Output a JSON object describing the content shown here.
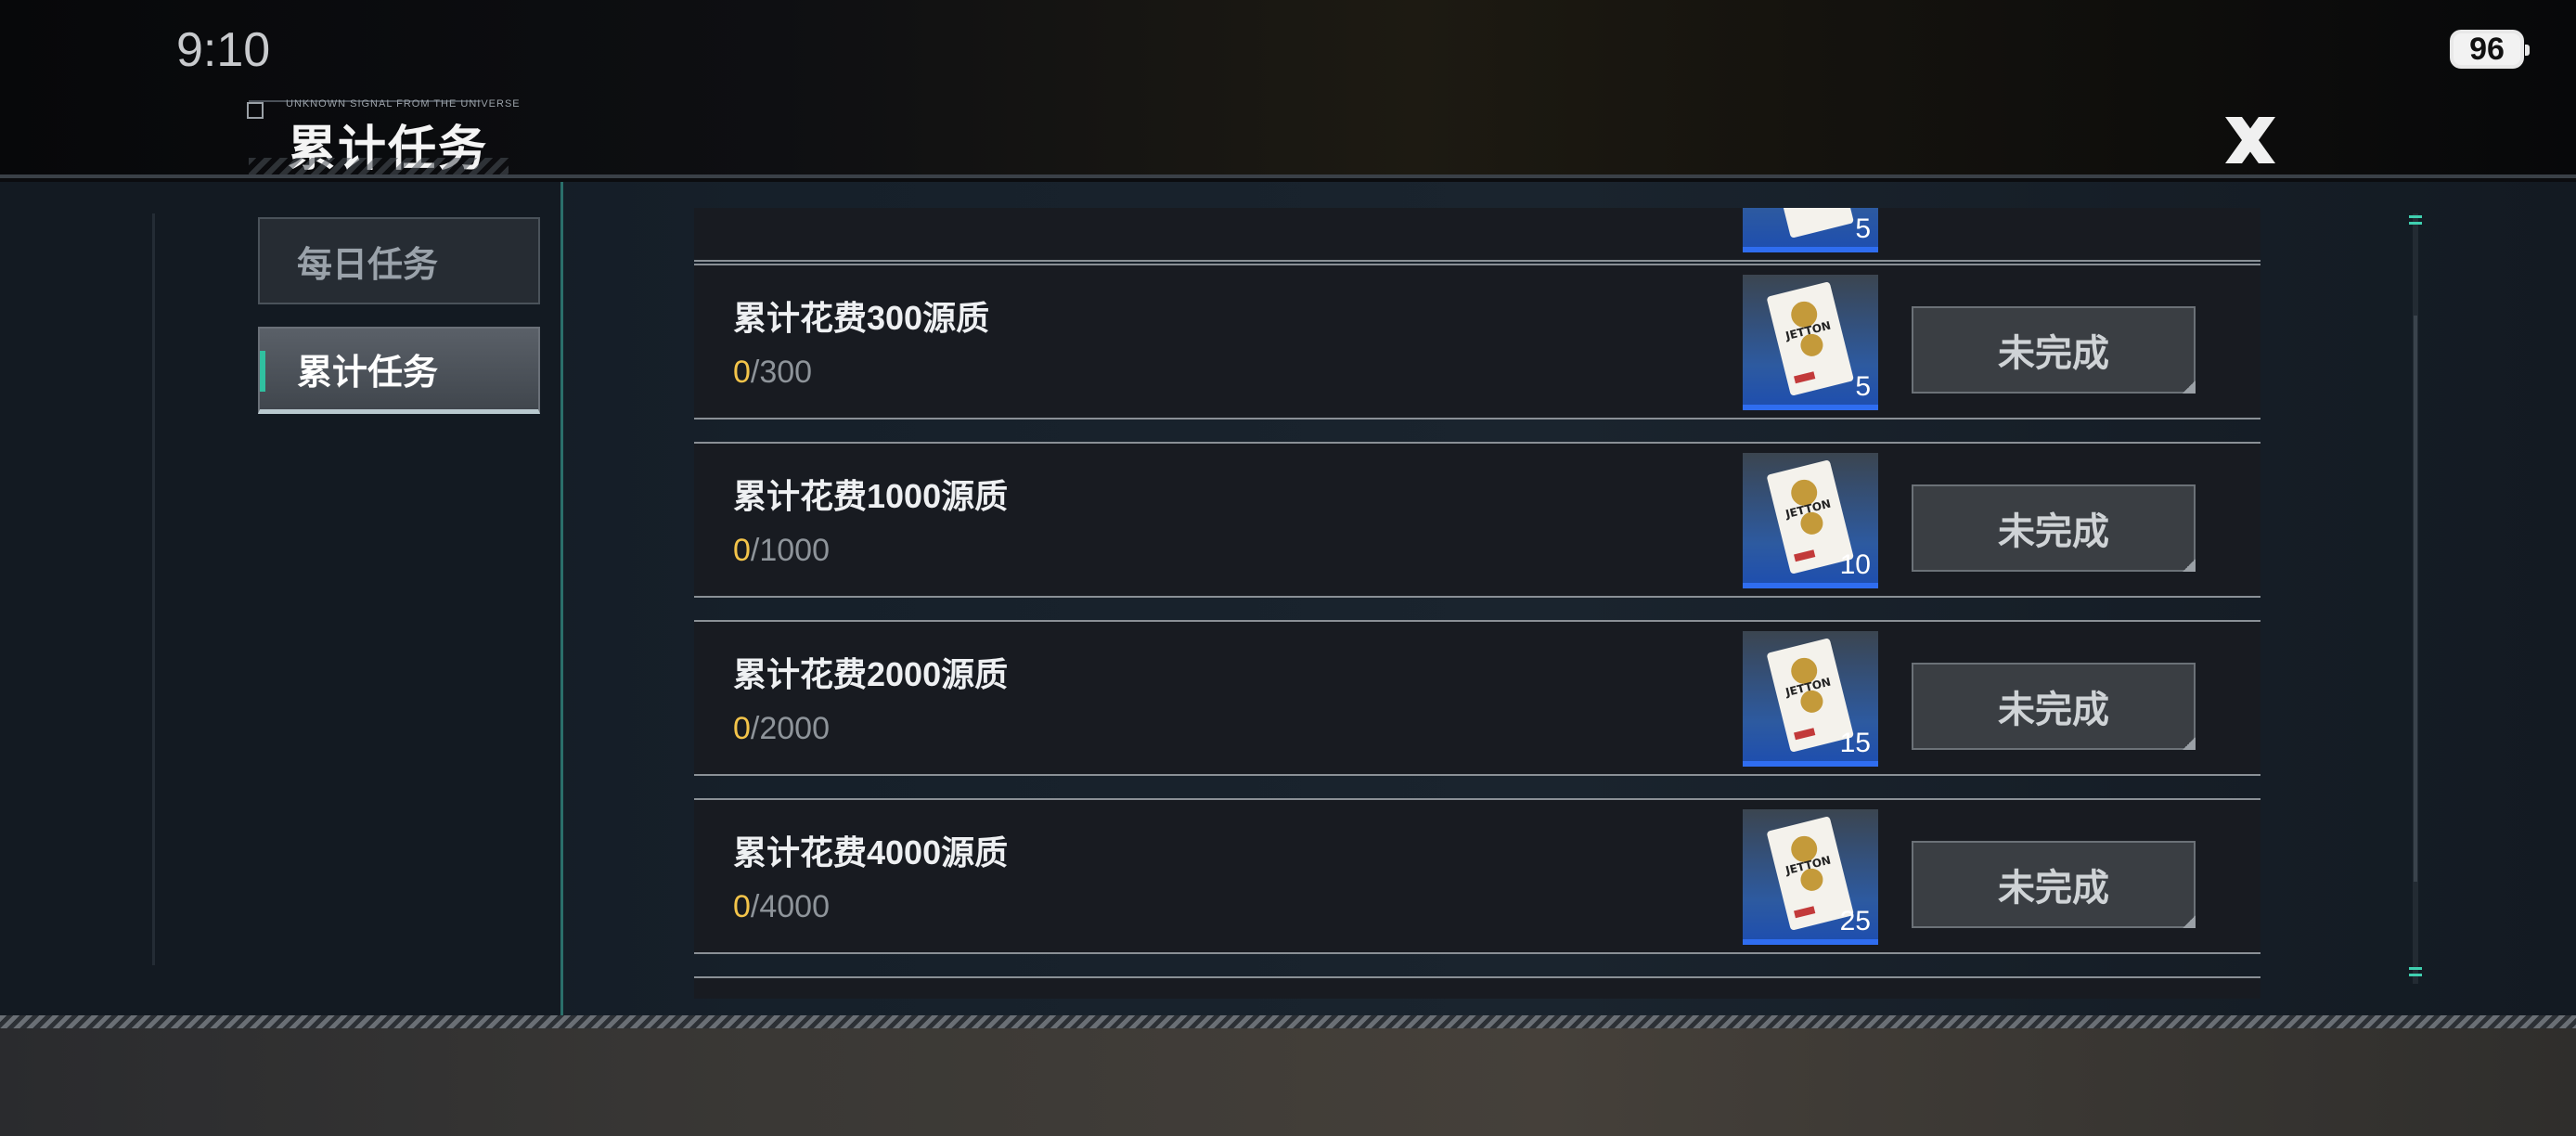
{
  "status_bar": {
    "time": "9:10",
    "battery": "96"
  },
  "header": {
    "small_caption": "UNKNOWN SIGNAL FROM THE UNIVERSE",
    "title": "累计任务"
  },
  "sidebar": {
    "tabs": [
      {
        "label": "每日任务",
        "selected": false
      },
      {
        "label": "累计任务",
        "selected": true
      }
    ]
  },
  "tasks": [
    {
      "title": "",
      "current": "",
      "total": "",
      "reward_count": "5"
    },
    {
      "title": "累计花费300源质",
      "current": "0",
      "total": "/300",
      "reward_count": "5",
      "status": "未完成"
    },
    {
      "title": "累计花费1000源质",
      "current": "0",
      "total": "/1000",
      "reward_count": "10",
      "status": "未完成"
    },
    {
      "title": "累计花费2000源质",
      "current": "0",
      "total": "/2000",
      "reward_count": "15",
      "status": "未完成"
    },
    {
      "title": "累计花费4000源质",
      "current": "0",
      "total": "/4000",
      "reward_count": "25",
      "status": "未完成"
    }
  ],
  "reward_item": {
    "icon": "jetton-card-icon",
    "label": "JETTON"
  },
  "colors": {
    "accent": "#30c0a0",
    "progress_current": "#f3c44a",
    "reward_bg": "#2d5aa0"
  }
}
